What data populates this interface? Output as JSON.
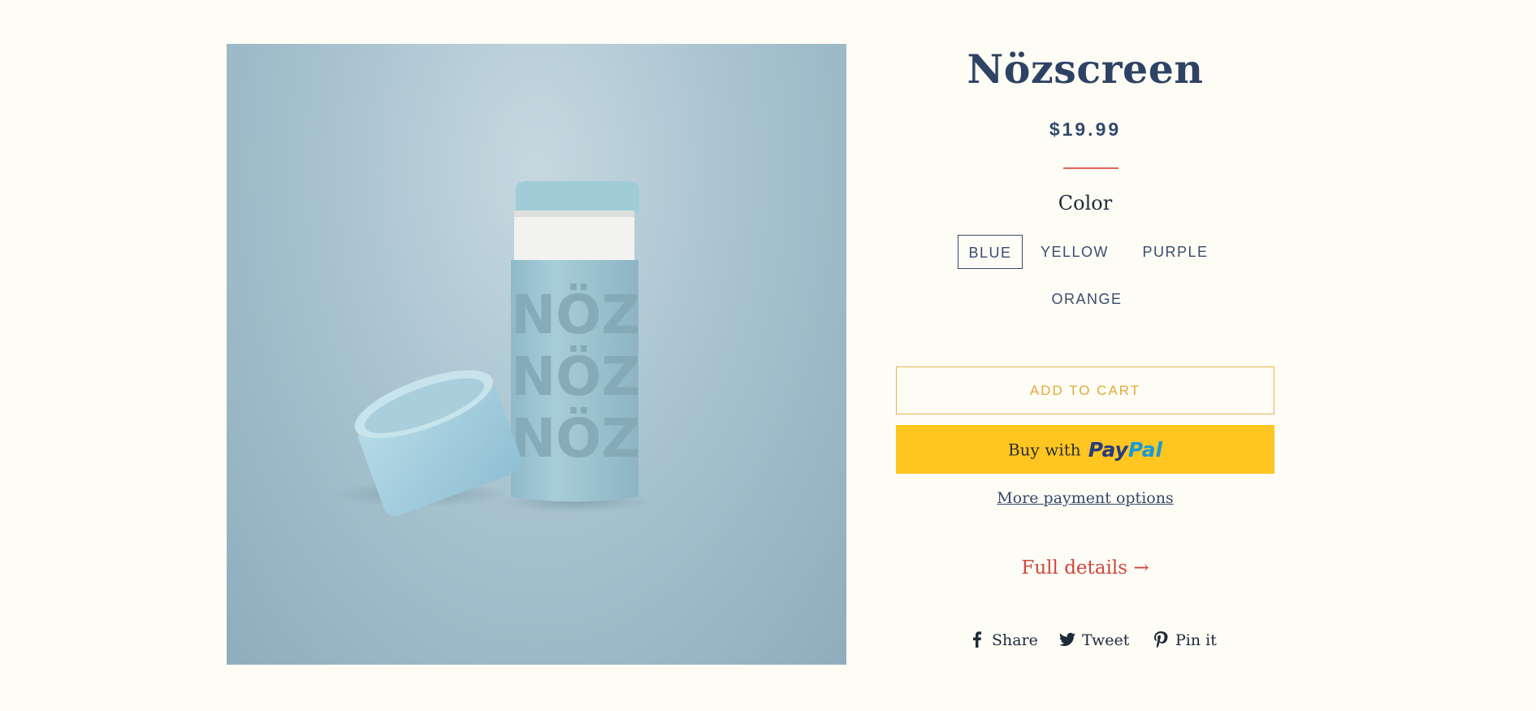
{
  "product": {
    "title": "Nözscreen",
    "price": "$19.99",
    "image_alt": "Nözscreen stick"
  },
  "options": {
    "label": "Color",
    "values": [
      "BLUE",
      "YELLOW",
      "PURPLE",
      "ORANGE"
    ],
    "selected": "BLUE"
  },
  "actions": {
    "add_to_cart": "ADD TO CART",
    "buy_with": "Buy with",
    "paypal_pay": "Pay",
    "paypal_pal": "Pal",
    "more_payment": "More payment options",
    "full_details": "Full details →"
  },
  "social": {
    "share": "Share",
    "tweet": "Tweet",
    "pin": "Pin it"
  },
  "colors": {
    "background": "#fdfdf5",
    "title": "#2e4263",
    "accent_red": "#d0463f",
    "paypal_yellow": "#ffc521",
    "cart_border": "#e7b54a"
  },
  "icons": [
    "facebook-icon",
    "twitter-icon",
    "pinterest-icon"
  ]
}
